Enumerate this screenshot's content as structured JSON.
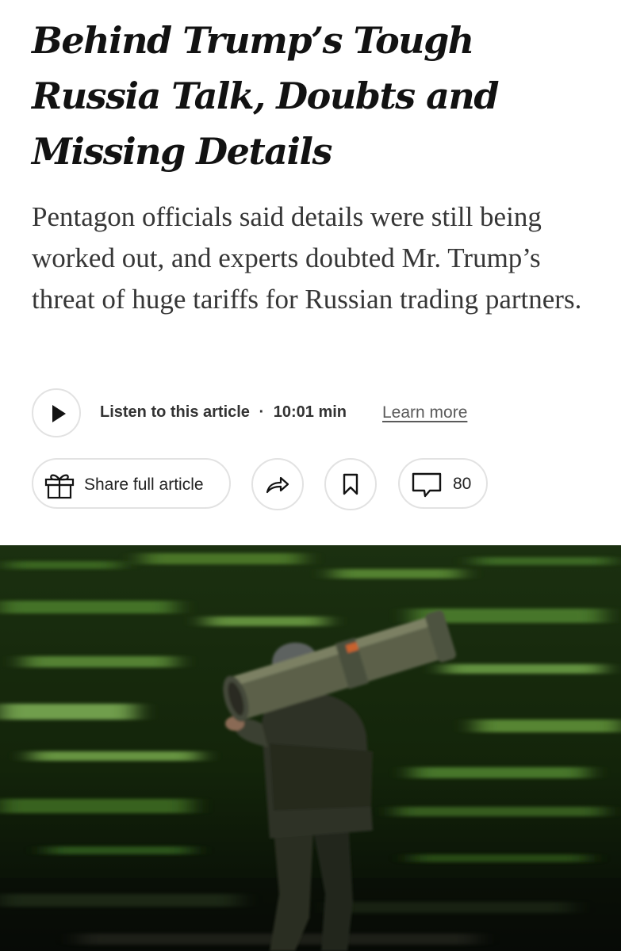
{
  "article": {
    "headline": "Behind Trump’s Tough Russia Talk, Doubts and Missing Details",
    "summary": "Pentagon officials said details were still being worked out, and experts doubted Mr. Trump’s threat of huge tariffs for Russian trading partners."
  },
  "audio": {
    "listen_label": "Listen to this article",
    "separator": "·",
    "duration": "10:01 min",
    "learn_more": "Learn more",
    "play_icon": "play-icon"
  },
  "actions": {
    "share_full_label": "Share full article",
    "gift_icon": "gift-icon",
    "share_icon": "share-arrow-icon",
    "save_icon": "bookmark-icon",
    "comment_icon": "comment-icon",
    "comment_count": "80"
  },
  "colors": {
    "text": "#121212",
    "summary_text": "#363636",
    "border": "#e2e2e2",
    "photo_foliage": "#2f5a1c"
  }
}
